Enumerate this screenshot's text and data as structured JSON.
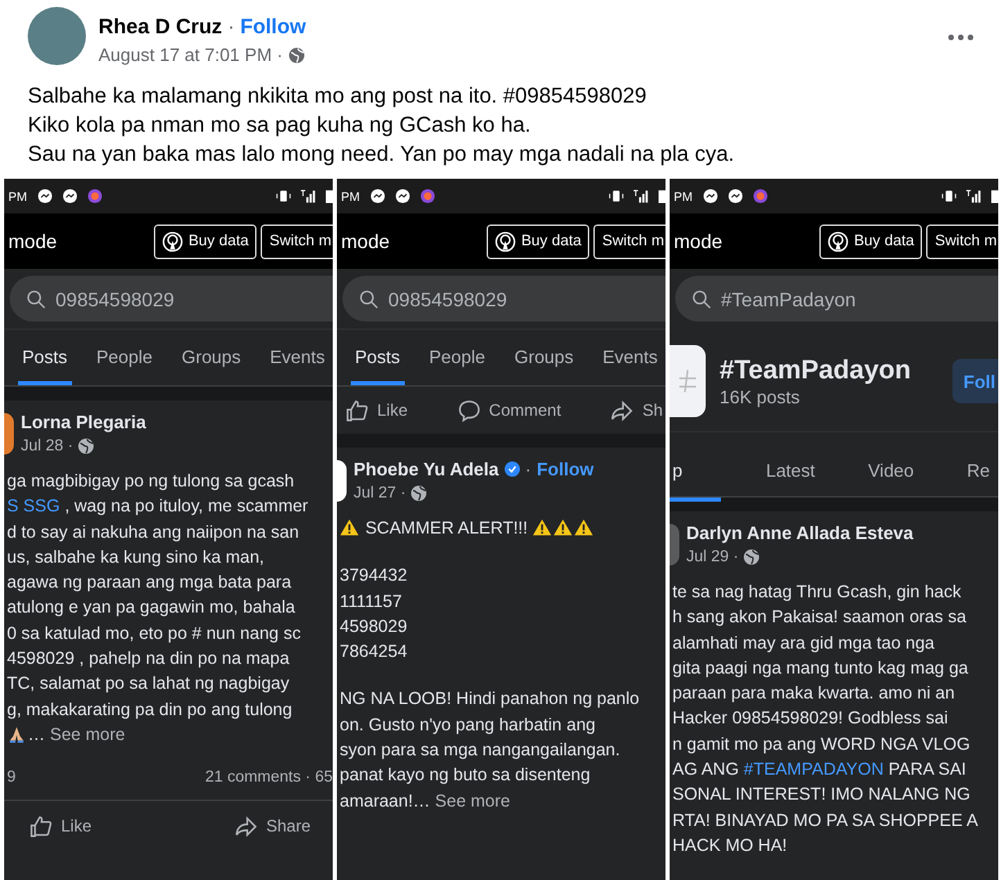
{
  "post": {
    "author": "Rhea D Cruz",
    "separator": "·",
    "follow": "Follow",
    "date": "August 17 at 7:01 PM ·",
    "lines": [
      "Salbahe ka malamang nkikita mo ang post na ito. #09854598029",
      "Kiko kola pa nman mo sa pag kuha ng GCash ko ha.",
      "Sau na yan baka mas lalo mong need. Yan po may mga nadali na pla cya."
    ]
  },
  "screenshots": [
    {
      "kind": "search_results",
      "status_time": "PM",
      "mode_label": "mode",
      "buy_data": "Buy data",
      "switch_mode": "Switch m",
      "search": "09854598029",
      "tabs": [
        {
          "label": "Posts",
          "selected": true
        },
        {
          "label": "People",
          "selected": false
        },
        {
          "label": "Groups",
          "selected": false
        },
        {
          "label": "Events",
          "selected": false
        }
      ],
      "post": {
        "author": "Lorna Plegaria",
        "verified": false,
        "date": "Jul 28 ·",
        "color": "#e07a2c",
        "paragraphs": [
          [
            [
              {
                "kind": "text",
                "text": "ga magbibigay po ng tulong sa gcash"
              }
            ],
            [
              {
                "kind": "link",
                "text": "S SSG"
              },
              {
                "kind": "text",
                "text": " , wag na po ituloy, me scammer"
              }
            ],
            [
              {
                "kind": "text",
                "text": "d to say ai nakuha ang naiipon na san"
              }
            ],
            [
              {
                "kind": "text",
                "text": "us, salbahe ka kung sino ka man,"
              }
            ],
            [
              {
                "kind": "text",
                "text": "agawa ng paraan ang mga bata para"
              }
            ],
            [
              {
                "kind": "text",
                "text": "atulong e yan pa gagawin mo, bahala"
              }
            ],
            [
              {
                "kind": "text",
                "text": "0 sa katulad mo, eto po # nun nang sc"
              }
            ],
            [
              {
                "kind": "text",
                "text": "4598029 , pahelp na din po na mapa"
              }
            ],
            [
              {
                "kind": "text",
                "text": "TC, salamat po sa lahat ng nagbigay"
              }
            ],
            [
              {
                "kind": "text",
                "text": "g, makakarating pa din po ang tulong"
              }
            ],
            [
              {
                "kind": "emoji"
              },
              {
                "kind": "text",
                "text": "… "
              },
              {
                "kind": "more",
                "text": "See more"
              }
            ]
          ]
        ],
        "reactions": "9",
        "comments": "21 comments · 65"
      },
      "bottom_actions": [
        {
          "kind": "like",
          "label": "Like"
        },
        {
          "kind": "share",
          "label": "Share"
        }
      ]
    },
    {
      "kind": "search_results",
      "status_time": "PM",
      "mode_label": "mode",
      "buy_data": "Buy data",
      "switch_mode": "Switch m",
      "search": "09854598029",
      "tabs": [
        {
          "label": "Posts",
          "selected": true
        },
        {
          "label": "People",
          "selected": false
        },
        {
          "label": "Groups",
          "selected": false
        },
        {
          "label": "Events",
          "selected": false
        }
      ],
      "top_actions": [
        {
          "kind": "like",
          "label": "Like"
        },
        {
          "kind": "comment",
          "label": "Comment"
        },
        {
          "kind": "share",
          "label": "Sh"
        }
      ],
      "post": {
        "author": "Phoebe Yu Adela",
        "verified": true,
        "separator": "·",
        "follow": "Follow",
        "date": "Jul 27 ·",
        "color": "#ffffff",
        "paragraphs": [
          [
            [
              {
                "kind": "warning"
              },
              {
                "kind": "text",
                "text": " SCAMMER ALERT!!! "
              },
              {
                "kind": "warning"
              },
              {
                "kind": "warning"
              },
              {
                "kind": "warning"
              }
            ]
          ],
          [
            [
              {
                "kind": "text",
                "text": "3794432"
              }
            ],
            [
              {
                "kind": "text",
                "text": "1111157"
              }
            ],
            [
              {
                "kind": "text",
                "text": "4598029"
              }
            ],
            [
              {
                "kind": "text",
                "text": "7864254"
              }
            ]
          ],
          [
            [
              {
                "kind": "text",
                "text": "NG NA LOOB! Hindi panahon ng panlo"
              }
            ],
            [
              {
                "kind": "text",
                "text": "on. Gusto n'yo pang harbatin ang"
              }
            ],
            [
              {
                "kind": "text",
                "text": "syon para sa mga nangangailangan."
              }
            ],
            [
              {
                "kind": "text",
                "text": "panat kayo ng buto sa disenteng"
              }
            ],
            [
              {
                "kind": "text",
                "text": "amaraan!… "
              },
              {
                "kind": "more",
                "text": "See more"
              }
            ]
          ]
        ]
      }
    },
    {
      "kind": "hashtag",
      "status_time": "PM",
      "mode_label": "mode",
      "buy_data": "Buy data",
      "switch_mode": "Switch m",
      "search": "#TeamPadayon",
      "hashtag": {
        "title": "#TeamPadayon",
        "count": "16K posts",
        "follow": "Foll"
      },
      "tabs": [
        {
          "label": "p",
          "selected": true
        },
        {
          "label": "Latest",
          "selected": false
        },
        {
          "label": "Video",
          "selected": false
        },
        {
          "label": "Re",
          "selected": false
        }
      ],
      "post": {
        "author": "Darlyn Anne Allada Esteva",
        "verified": false,
        "date": "Jul 29 ·",
        "color": "#5a5b5d",
        "paragraphs": [
          [
            [
              {
                "kind": "text",
                "text": "te sa nag hatag Thru Gcash, gin hack"
              }
            ],
            [
              {
                "kind": "text",
                "text": "h sang akon Pakaisa! saamon oras sa"
              }
            ],
            [
              {
                "kind": "text",
                "text": "alamhati may ara gid mga tao nga"
              }
            ],
            [
              {
                "kind": "text",
                "text": "gita paagi nga mang tunto kag mag ga"
              }
            ],
            [
              {
                "kind": "text",
                "text": "paraan para maka kwarta. amo ni an"
              }
            ],
            [
              {
                "kind": "text",
                "text": "Hacker 09854598029! Godbless sai"
              }
            ],
            [
              {
                "kind": "text",
                "text": "n gamit mo pa ang WORD NGA VLOG"
              }
            ],
            [
              {
                "kind": "text",
                "text": "AG ANG "
              },
              {
                "kind": "link",
                "text": "#TEAMPADAYON"
              },
              {
                "kind": "text",
                "text": " PARA SAI"
              }
            ],
            [
              {
                "kind": "text",
                "text": "SONAL INTEREST! IMO NALANG NG"
              }
            ],
            [
              {
                "kind": "text",
                "text": "RTA! BINAYAD MO PA SA SHOPPEE A"
              }
            ],
            [
              {
                "kind": "text",
                "text": "HACK MO HA!"
              }
            ]
          ]
        ]
      }
    }
  ]
}
